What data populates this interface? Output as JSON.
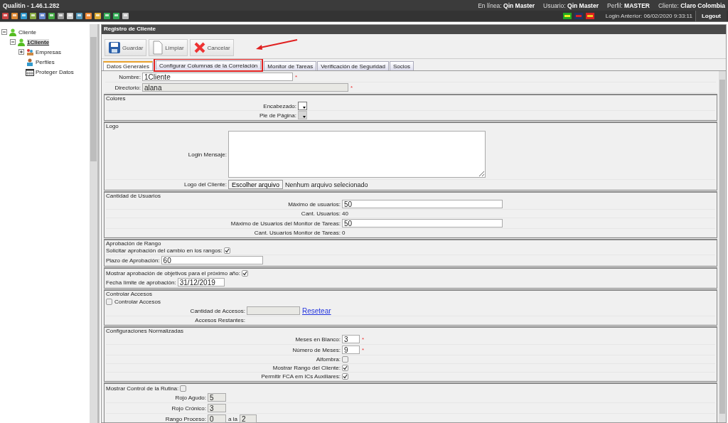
{
  "app": {
    "title": "Qualitin - 1.46.1.282"
  },
  "status": [
    {
      "label": "En línea:",
      "value": "Qin Master"
    },
    {
      "label": "Usuario:",
      "value": "Qin Master"
    },
    {
      "label": "Perfil:",
      "value": "MASTER"
    },
    {
      "label": "Cliente:",
      "value": "Claro Colombia"
    }
  ],
  "login_info": "Login Anterior: 06/02/2020 9:33:11",
  "logout": "Logout",
  "tree": [
    {
      "kind": "folder",
      "label": "Cliente",
      "expanded": true,
      "selected": false,
      "children": [
        {
          "kind": "folder",
          "label": "1Cliente",
          "expanded": true,
          "selected": true,
          "children": [
            {
              "kind": "folder",
              "label": "Empresas",
              "expanded": false,
              "selected": false
            },
            {
              "kind": "leaf",
              "label": "Perfiles",
              "selected": false
            },
            {
              "kind": "leaf",
              "label": "Proteger Datos",
              "selected": false
            }
          ]
        }
      ]
    }
  ],
  "panel": {
    "title": "Registro de Cliente",
    "buttons": [
      {
        "kind": "save",
        "label": "Guardar"
      },
      {
        "kind": "clear",
        "label": "Limpiar"
      },
      {
        "kind": "cancel",
        "label": "Cancelar"
      }
    ],
    "tabs": [
      {
        "label": "Datos Generales",
        "selected": true,
        "highlighted": false
      },
      {
        "label": "Configurar Columnas de la Correlación",
        "selected": false,
        "highlighted": true
      },
      {
        "label": "Monitor de Tareas",
        "selected": false,
        "highlighted": false
      },
      {
        "label": "Verificación de Seguridad",
        "selected": false,
        "highlighted": false
      },
      {
        "label": "Socios",
        "selected": false,
        "highlighted": false
      }
    ],
    "required_mark": "*",
    "sections": [
      {
        "kind": "bare",
        "rows": [
          {
            "kind": "input",
            "label": "Nombre:",
            "value": "1Cliente",
            "required": true,
            "disabled": false
          },
          {
            "kind": "input",
            "label": "Directorio:",
            "value": "alana",
            "required": true,
            "disabled": true
          }
        ]
      },
      {
        "kind": "titled",
        "legend": "Colores",
        "rows": [
          {
            "kind": "color",
            "label": "Encabezado:",
            "disabled": false
          },
          {
            "kind": "color",
            "label": "Pie de Página:",
            "disabled": true
          }
        ]
      },
      {
        "kind": "titled",
        "legend": "Logo",
        "rows": [
          {
            "kind": "textarea",
            "label": "Login Mensaje:"
          },
          {
            "kind": "file",
            "label": "Logo del Cliente:",
            "button": "Escolher arquivo",
            "status": "Nenhum arquivo selecionado"
          }
        ]
      },
      {
        "kind": "titled",
        "legend": "Cantidad de Usuarios",
        "rows": [
          {
            "kind": "input",
            "label": "Máximo de usuarios:",
            "value": "50",
            "required": false,
            "disabled": false
          },
          {
            "kind": "readout",
            "label": "Cant. Usuarios:",
            "value": "40"
          },
          {
            "kind": "input",
            "label": "Máximo de Usuarios del Monitor de Tareas:",
            "value": "50",
            "required": false,
            "disabled": false
          },
          {
            "kind": "readout",
            "label": "Cant. Usuarios Monitor de Tareas:",
            "value": "0"
          }
        ]
      },
      {
        "kind": "titled",
        "legend": "Aprobación de Rango",
        "rows": [
          {
            "kind": "checkbox",
            "label": "Solicitar aprobación del cambio en los rangos:",
            "checked": true
          },
          {
            "kind": "input",
            "label": "Plazo de Aprobación:",
            "value": "60",
            "required": false,
            "disabled": false
          }
        ]
      },
      {
        "kind": "check_legend",
        "legend": "Mostrar aprobación de objetivos para el próximo año:",
        "checked": true,
        "rows": [
          {
            "kind": "input",
            "label": "Fecha límite de aprobación:",
            "value": "31/12/2019",
            "required": false,
            "disabled": false
          }
        ]
      },
      {
        "kind": "titled",
        "legend": "Controlar Accesos",
        "rows": [
          {
            "kind": "checkbox_left",
            "label": "Controlar Accesos",
            "checked": false
          },
          {
            "kind": "input_link",
            "label": "Cantidad de Accesos:",
            "link": "Resetear"
          },
          {
            "kind": "label_only",
            "label": "Accesos Restantes:"
          }
        ]
      },
      {
        "kind": "titled",
        "legend": "Configuraciones Normalizadas",
        "rows": [
          {
            "kind": "input",
            "label": "Meses en Blanco:",
            "value": "3",
            "required": true,
            "disabled": false
          },
          {
            "kind": "input",
            "label": "Número de Meses:",
            "value": "9",
            "required": true,
            "disabled": false
          },
          {
            "kind": "checkbox",
            "label": "Alfombra:",
            "checked": false
          },
          {
            "kind": "checkbox",
            "label": "Mostrar Rango del Cliente:",
            "checked": true
          },
          {
            "kind": "checkbox",
            "label": "Permitir FCA em ICs Auxiliares:",
            "checked": true
          }
        ]
      },
      {
        "kind": "check_legend",
        "legend": "Mostrar Control de la Rutina:",
        "checked": false,
        "rows": [
          {
            "kind": "input",
            "label": "Rojo Agudo:",
            "value": "5",
            "required": false,
            "disabled": true
          },
          {
            "kind": "input",
            "label": "Rojo Crónico:",
            "value": "3",
            "required": false,
            "disabled": true
          },
          {
            "kind": "range",
            "label": "Rango Proceso:",
            "from": "0",
            "separator": "a la",
            "to": "2"
          }
        ]
      }
    ]
  }
}
